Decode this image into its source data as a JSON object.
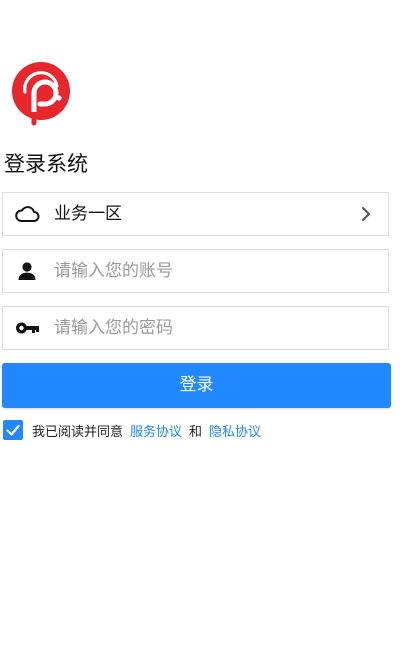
{
  "colors": {
    "brand_red": "#e8262e",
    "primary_blue": "#2288ff",
    "placeholder_gray": "#9a9a9a",
    "border_gray": "#dedede"
  },
  "logo": {
    "icon": "app-logo-icon"
  },
  "title": "登录系统",
  "region": {
    "icon": "cloud-icon",
    "value": "业务一区",
    "chevron_icon": "chevron-right-icon"
  },
  "account": {
    "icon": "user-icon",
    "placeholder": "请输入您的账号"
  },
  "password": {
    "icon": "key-icon",
    "placeholder": "请输入您的密码"
  },
  "login_button": {
    "label": "登录"
  },
  "agreement": {
    "checked": true,
    "prefix": "我已阅读并同意",
    "service_link": "服务协议",
    "conjunction": "和",
    "privacy_link": "隐私协议"
  }
}
